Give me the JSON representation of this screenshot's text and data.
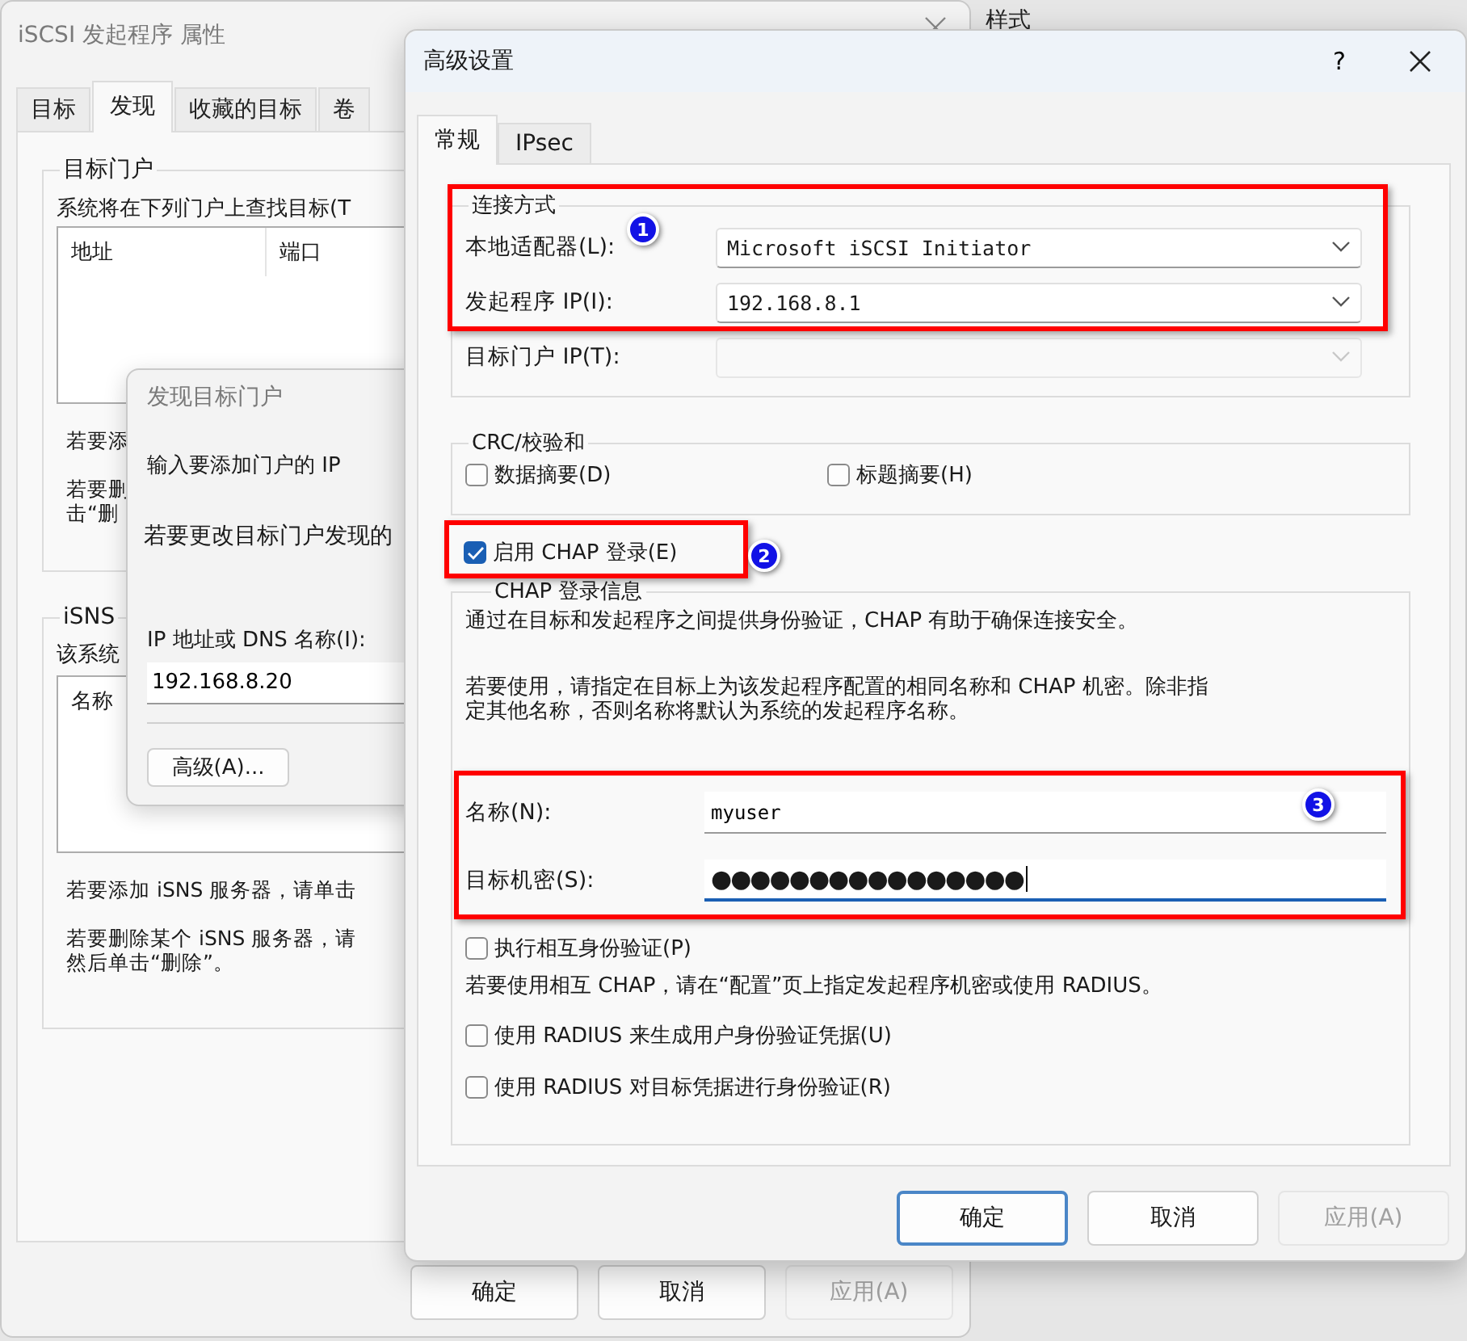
{
  "background_app": {
    "label": "样式"
  },
  "properties_window": {
    "title": "iSCSI 发起程序 属性",
    "tabs": [
      {
        "label": "目标",
        "selected": false
      },
      {
        "label": "发现",
        "selected": true
      },
      {
        "label": "收藏的目标",
        "selected": false
      },
      {
        "label": "卷",
        "selected": false
      }
    ],
    "portal_group": {
      "title": "目标门户",
      "description": "系统将在下列门户上查找目标(T",
      "columns": [
        "地址",
        "端口"
      ]
    },
    "portal_hints": [
      {
        "lines": [
          "若要添"
        ]
      },
      {
        "lines": [
          "若要删",
          "击“删"
        ]
      }
    ],
    "isns_group": {
      "title": "iSNS",
      "description": "该系统",
      "columns": [
        "名称"
      ],
      "hints": [
        {
          "lines": [
            "若要添加 iSNS 服务器，请单击"
          ]
        },
        {
          "lines": [
            "若要删除某个 iSNS 服务器，请",
            "然后单击“删除”。"
          ]
        }
      ]
    },
    "buttons": [
      {
        "label": "确定",
        "disabled": false
      },
      {
        "label": "取消",
        "disabled": false
      },
      {
        "label": "应用(A)",
        "disabled": true
      }
    ]
  },
  "discover_dialog": {
    "title": "发现目标门户",
    "prompt": "输入要添加门户的 IP",
    "note": "若要更改目标门户发现的",
    "address_label": "IP 地址或 DNS 名称(I):",
    "address_value": "192.168.8.20",
    "advanced_button": "高级(A)..."
  },
  "advanced_dialog": {
    "title": "高级设置",
    "help": "?",
    "tabs": [
      {
        "label": "常规",
        "selected": true
      },
      {
        "label": "IPsec",
        "selected": false
      }
    ],
    "connection_group": {
      "title": "连接方式",
      "fields": [
        {
          "label": "本地适配器(L):",
          "value": "Microsoft iSCSI Initiator",
          "disabled": false
        },
        {
          "label": "发起程序 IP(I):",
          "value": "192.168.8.1",
          "disabled": false
        },
        {
          "label": "目标门户 IP(T):",
          "disabled": true
        }
      ]
    },
    "crc_group": {
      "title": "CRC/校验和",
      "options": [
        {
          "label": "数据摘要(D)",
          "checked": false
        },
        {
          "label": "标题摘要(H)",
          "checked": false
        }
      ]
    },
    "chap_enable": {
      "label": "启用 CHAP 登录(E)",
      "checked": true
    },
    "chap_group": {
      "title": "CHAP 登录信息",
      "intro": "通过在目标和发起程序之间提供身份验证，CHAP 有助于确保连接安全。",
      "usage": "若要使用，请指定在目标上为该发起程序配置的相同名称和 CHAP 机密。除非指定其他名称，否则名称将默认为系统的发起程序名称。",
      "name_label": "名称(N):",
      "name_value": "myuser",
      "secret_label": "目标机密(S):",
      "secret_value": "●●●●●●●●●●●●●●●●",
      "mutual": {
        "label": "执行相互身份验证(P)",
        "checked": false
      },
      "mutual_note": "若要使用相互 CHAP，请在“配置”页上指定发起程序机密或使用 RADIUS。",
      "radius": [
        {
          "label": "使用 RADIUS 来生成用户身份验证凭据(U)",
          "checked": false
        },
        {
          "label": "使用 RADIUS 对目标凭据进行身份验证(R)",
          "checked": false
        }
      ]
    },
    "buttons": [
      {
        "label": "确定",
        "disabled": false
      },
      {
        "label": "取消",
        "disabled": false
      },
      {
        "label": "应用(A)",
        "disabled": true
      }
    ]
  },
  "annotations": [
    {
      "number": "1"
    },
    {
      "number": "2"
    },
    {
      "number": "3"
    }
  ]
}
